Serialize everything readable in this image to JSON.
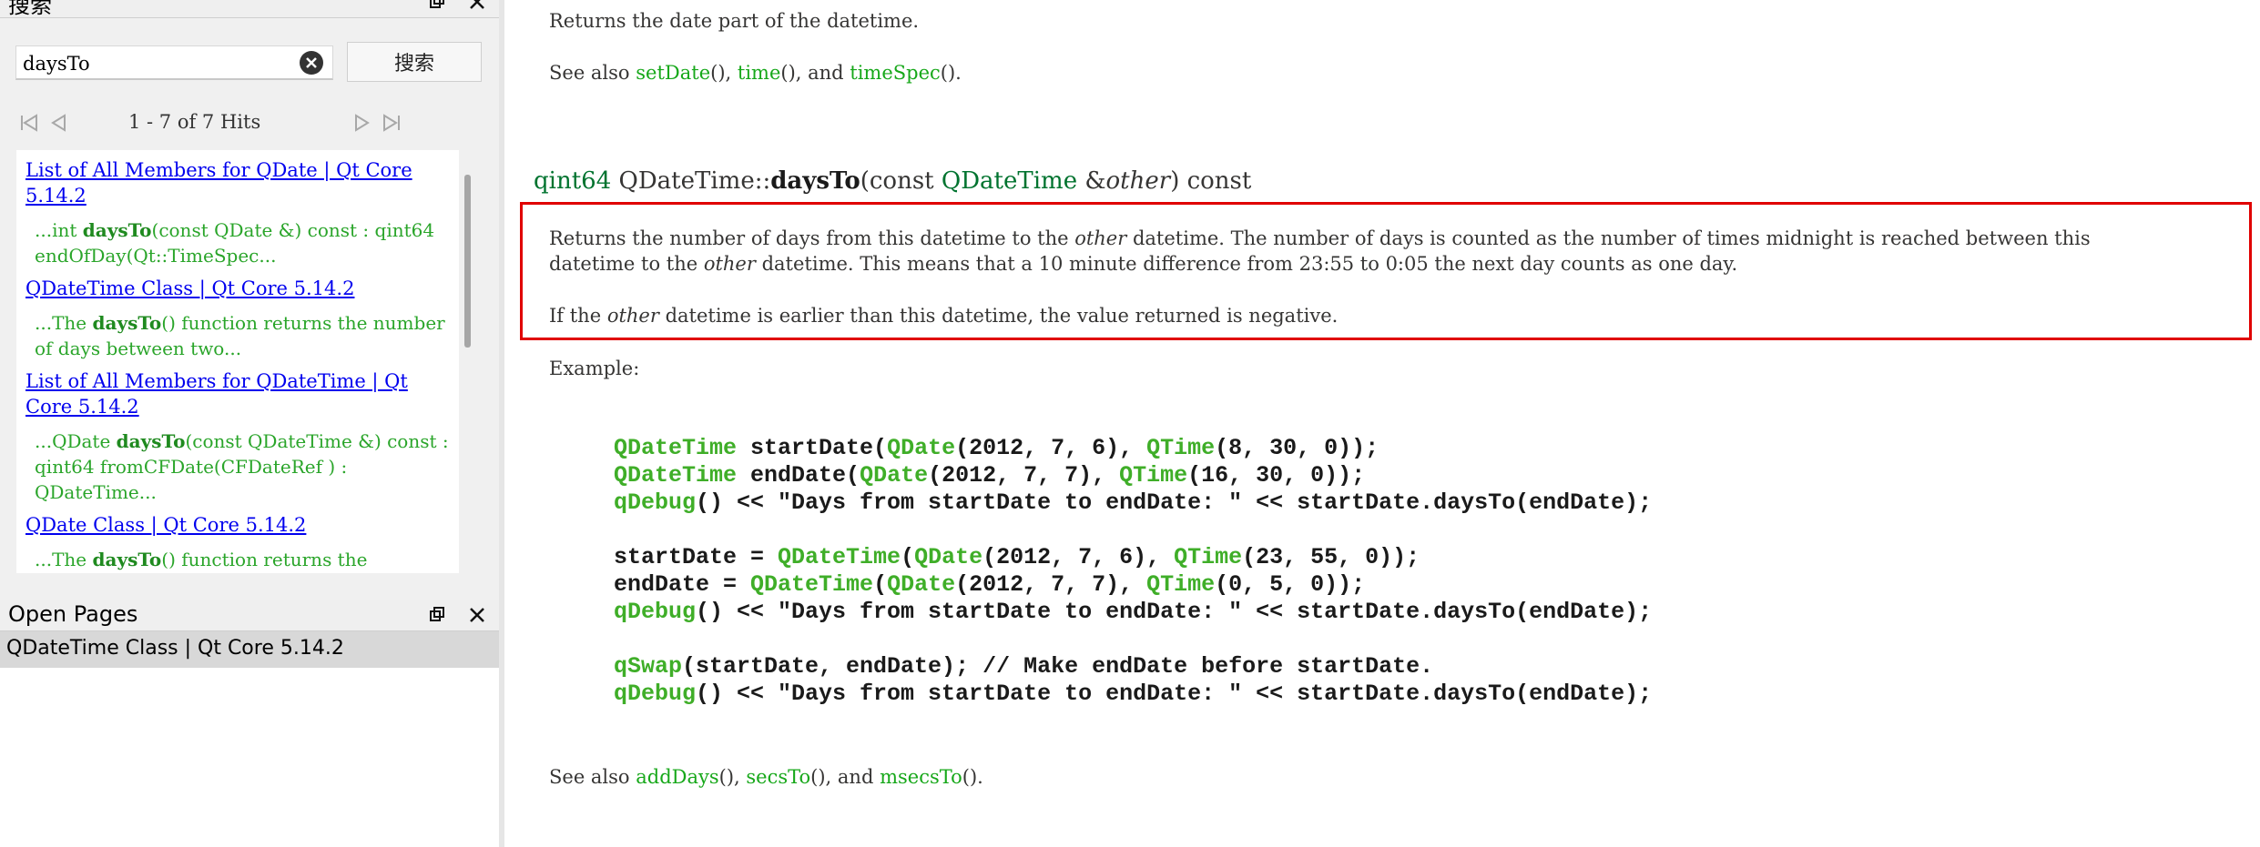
{
  "search_pane": {
    "title": "搜索",
    "query": "daysTo",
    "search_button": "搜索",
    "hits": "1 - 7 of 7 Hits",
    "results": [
      {
        "title": "List of All Members for QDate | Qt Core 5.14.2",
        "snippet_pre": "...int ",
        "snippet_match": "daysTo",
        "snippet_post": "(const QDate &) const : qint64 endOfDay(Qt::TimeSpec..."
      },
      {
        "title": "QDateTime Class | Qt Core 5.14.2",
        "snippet_pre": "...The ",
        "snippet_match": "daysTo",
        "snippet_post": "() function returns the number of days between two..."
      },
      {
        "title": "List of All Members for QDateTime | Qt Core 5.14.2",
        "snippet_pre": "...QDate ",
        "snippet_match": "daysTo",
        "snippet_post": "(const QDateTime &) const : qint64 fromCFDate(CFDateRef ) : QDateTime..."
      },
      {
        "title": "QDate Class | Qt Core 5.14.2",
        "snippet_pre": "...The ",
        "snippet_match": "daysTo",
        "snippet_post": "() function returns the"
      }
    ]
  },
  "open_pages": {
    "title": "Open Pages",
    "items": [
      "QDateTime Class | Qt Core 5.14.2"
    ]
  },
  "doc": {
    "top_line": "Returns the date part of the datetime.",
    "see_also_1": {
      "prefix": "See also ",
      "links": [
        "setDate",
        "time",
        "timeSpec"
      ],
      "sep1": "(), ",
      "sep2": "(), and ",
      "end": "()."
    },
    "signature": {
      "ret": "qint64",
      "cls": "QDateTime::",
      "fn": "daysTo",
      "open": "(const ",
      "ptype": "QDateTime",
      "amp": " &",
      "param": "other",
      "close": ") const"
    },
    "para1_a": "Returns the number of days from this datetime to the ",
    "para1_b": " datetime. The number of days is counted as the number of times midnight is reached between this",
    "para1_c": "datetime to the ",
    "para1_d": " datetime. This means that a 10 minute difference from 23:55 to 0:05 the next day counts as one day.",
    "para2_a": "If the ",
    "para2_b": " datetime is earlier than this datetime, the value returned is negative.",
    "other_word": "other",
    "example_label": "Example:",
    "see_also_2": {
      "prefix": "See also ",
      "links": [
        "addDays",
        "secsTo",
        "msecsTo"
      ],
      "sep1": "(), ",
      "sep2": "(), and ",
      "end": "()."
    }
  },
  "code_tokens": {
    "QDateTime": "QDateTime",
    "QDate": "QDate",
    "QTime": "QTime",
    "qDebug": "qDebug",
    "qSwap": "qSwap",
    "l1_a": " startDate(",
    "l1_b": "(2012, 7, 6), ",
    "l1_c": "(8, 30, 0));",
    "l2_a": " endDate(",
    "l2_b": "(2012, 7, 7), ",
    "l2_c": "(16, 30, 0));",
    "dbg": "() << \"Days from startDate to endDate: \" << startDate.daysTo(endDate);",
    "l4_a": "startDate = ",
    "l4_b": "(",
    "l4_c": "(2012, 7, 6), ",
    "l4_d": "(23, 55, 0));",
    "l5_a": "endDate = ",
    "l5_c": "(2012, 7, 7), ",
    "l5_d": "(0, 5, 0));",
    "swap": "(startDate, endDate); // Make endDate before startDate."
  },
  "colors": {
    "link": "#17a81a",
    "type": "#00732f",
    "highlight": "#e00000",
    "result_link": "#0000ee"
  },
  "icons": [
    "restore-icon",
    "close-icon",
    "clear-search-icon",
    "first-page-icon",
    "previous-page-icon",
    "next-page-icon",
    "last-page-icon"
  ]
}
